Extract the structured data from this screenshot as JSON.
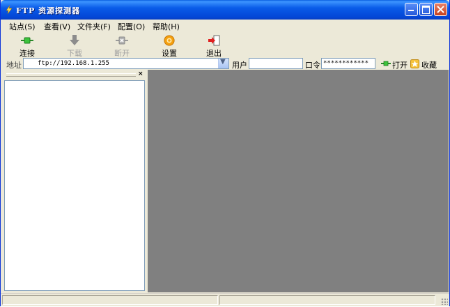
{
  "window": {
    "title": "FTP 资源探测器"
  },
  "menu": [
    {
      "label": "站点(S)"
    },
    {
      "label": "查看(V)"
    },
    {
      "label": "文件夹(F)"
    },
    {
      "label": "配置(O)"
    },
    {
      "label": "帮助(H)"
    }
  ],
  "toolbar": [
    {
      "label": "连接",
      "icon": "connect-icon",
      "enabled": true
    },
    {
      "label": "下载",
      "icon": "download-icon",
      "enabled": false
    },
    {
      "label": "断开",
      "icon": "disconnect-icon",
      "enabled": false
    },
    {
      "label": "设置",
      "icon": "settings-gear-icon",
      "enabled": true
    },
    {
      "label": "退出",
      "icon": "exit-icon",
      "enabled": true
    }
  ],
  "address": {
    "label": "地址",
    "value": "ftp://192.168.1.255",
    "user_label": "用户",
    "user_value": "",
    "password_label": "口令",
    "password_value": "************",
    "open_label": "打开",
    "favorites_label": "收藏"
  },
  "left_pane": {
    "close_glyph": "×"
  },
  "colors": {
    "title_bar": "#0a5ce8",
    "content_bg": "#808080",
    "chrome": "#ece9d8"
  }
}
